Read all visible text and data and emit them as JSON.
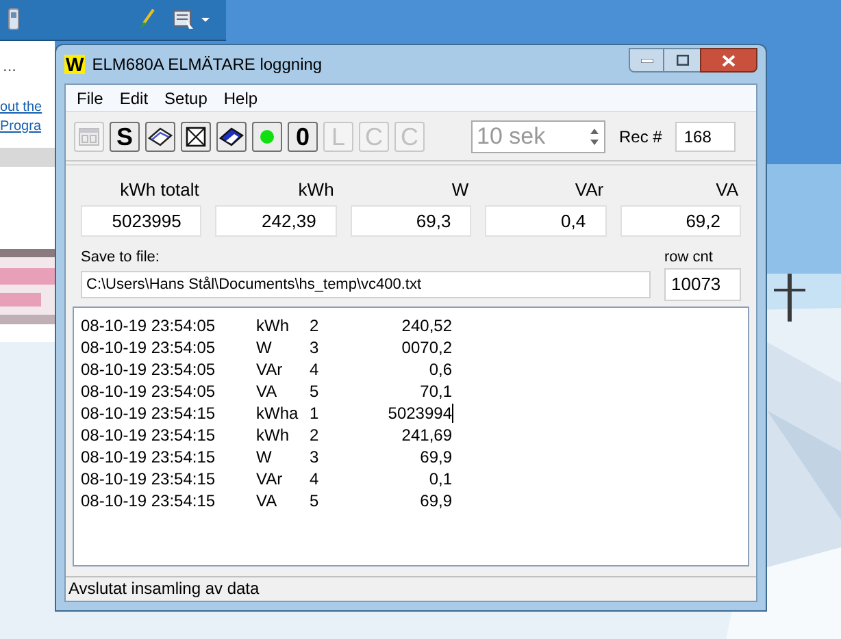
{
  "back_window": {
    "caption": "...",
    "links": [
      "out the",
      "Progra"
    ]
  },
  "window": {
    "title": "ELM680A ELMÄTARE loggning",
    "logo": "W"
  },
  "menu": [
    "File",
    "Edit",
    "Setup",
    "Help"
  ],
  "toolbar": [
    {
      "kind": "icon",
      "disabled": true
    },
    {
      "kind": "letter",
      "label": "S",
      "disabled": false
    },
    {
      "kind": "icon",
      "disabled": false
    },
    {
      "kind": "icon",
      "disabled": false
    },
    {
      "kind": "icon",
      "disabled": false
    },
    {
      "kind": "icon",
      "disabled": false
    },
    {
      "kind": "letter",
      "label": "0",
      "disabled": false
    },
    {
      "kind": "letter",
      "label": "L",
      "disabled": true
    },
    {
      "kind": "letter",
      "label": "C",
      "disabled": true
    },
    {
      "kind": "letter",
      "label": "C",
      "disabled": true
    }
  ],
  "interval": {
    "value": "10 sek"
  },
  "record": {
    "label": "Rec #",
    "value": "168"
  },
  "readings": [
    {
      "label": "kWh totalt",
      "value": "5023995"
    },
    {
      "label": "kWh",
      "value": "242,39"
    },
    {
      "label": "W",
      "value": "69,3"
    },
    {
      "label": "VAr",
      "value": "0,4"
    },
    {
      "label": "VA",
      "value": "69,2"
    }
  ],
  "save": {
    "label": "Save to file:",
    "path": "C:\\Users\\Hans Stål\\Documents\\hs_temp\\vc400.txt"
  },
  "row_count": {
    "label": "row cnt",
    "value": "10073"
  },
  "log": [
    {
      "time": "08-10-19 23:54:05",
      "unit": "kWh",
      "channel": "2",
      "value": "240,52",
      "cursor": false
    },
    {
      "time": "08-10-19 23:54:05",
      "unit": "W",
      "channel": "3",
      "value": "0070,2",
      "cursor": false
    },
    {
      "time": "08-10-19 23:54:05",
      "unit": "VAr",
      "channel": "4",
      "value": "0,6",
      "cursor": false
    },
    {
      "time": "08-10-19 23:54:05",
      "unit": "VA",
      "channel": "5",
      "value": "70,1",
      "cursor": false
    },
    {
      "time": "08-10-19 23:54:15",
      "unit": "kWha",
      "channel": "1",
      "value": "5023994",
      "cursor": true
    },
    {
      "time": "08-10-19 23:54:15",
      "unit": "kWh",
      "channel": "2",
      "value": "241,69",
      "cursor": false
    },
    {
      "time": "08-10-19 23:54:15",
      "unit": "W",
      "channel": "3",
      "value": "69,9",
      "cursor": false
    },
    {
      "time": "08-10-19 23:54:15",
      "unit": "VAr",
      "channel": "4",
      "value": "0,1",
      "cursor": false
    },
    {
      "time": "08-10-19 23:54:15",
      "unit": "VA",
      "channel": "5",
      "value": "69,9",
      "cursor": false
    }
  ],
  "status_bar": "Avslutat insamling av data"
}
